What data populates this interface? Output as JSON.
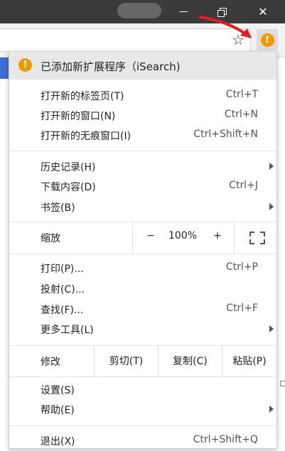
{
  "window": {
    "minimize": "—",
    "close": "✕"
  },
  "toolbar": {
    "bookmark_icon": "star-outline",
    "extension_badge": "!"
  },
  "menu": {
    "banner": {
      "icon": "!",
      "text": "已添加新扩展程序（iSearch)"
    },
    "tabs_group": [
      {
        "label": "打开新的标签页(T)",
        "shortcut": "Ctrl+T"
      },
      {
        "label": "打开新的窗口(N)",
        "shortcut": "Ctrl+N"
      },
      {
        "label": "打开新的无痕窗口(I)",
        "shortcut": "Ctrl+Shift+N"
      }
    ],
    "history_group": [
      {
        "label": "历史记录(H)",
        "shortcut": ""
      },
      {
        "label": "下载内容(D)",
        "shortcut": "Ctrl+J"
      },
      {
        "label": "书签(B)",
        "shortcut": ""
      }
    ],
    "zoom": {
      "label": "缩放",
      "minus": "−",
      "value": "100%",
      "plus": "+"
    },
    "tools_group": [
      {
        "label": "打印(P)...",
        "shortcut": "Ctrl+P"
      },
      {
        "label": "投射(C)...",
        "shortcut": ""
      },
      {
        "label": "查找(F)...",
        "shortcut": "Ctrl+F"
      },
      {
        "label": "更多工具(L)",
        "shortcut": ""
      }
    ],
    "edit": {
      "label": "修改",
      "cut": "剪切(T)",
      "copy": "复制(C)",
      "paste": "粘贴(P)"
    },
    "settings_group": [
      {
        "label": "设置(S)",
        "shortcut": ""
      },
      {
        "label": "帮助(E)",
        "shortcut": ""
      }
    ],
    "exit": {
      "label": "退出(X)",
      "shortcut": "Ctrl+Shift+Q"
    }
  },
  "colors": {
    "accent_orange": "#f29900",
    "titlebar": "#3a3a3a",
    "arrow_red": "#e02020"
  }
}
